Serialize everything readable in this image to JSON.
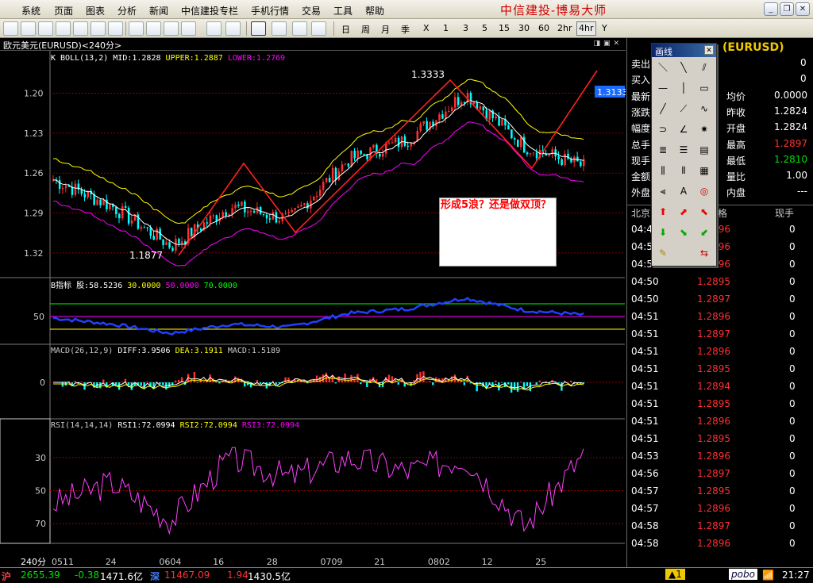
{
  "menu": {
    "items": [
      "系统",
      "页面",
      "图表",
      "分析",
      "新闻",
      "中信建投专栏",
      "手机行情",
      "交易",
      "工具",
      "帮助"
    ],
    "brand": "中信建投-博易大师"
  },
  "toolbar": {
    "periods": [
      "日",
      "周",
      "月",
      "季",
      "X",
      "1",
      "3",
      "5",
      "15",
      "30",
      "60",
      "2hr",
      "4hr",
      "Y"
    ],
    "selected_period": "4hr"
  },
  "chart": {
    "title": "欧元美元(EURUSD)<240分>",
    "period_label": "240分",
    "boll": {
      "label": "K BOLL(13,2)",
      "mid": "MID:1.2828",
      "upper": "UPPER:1.2887",
      "lower": "LOWER:1.2769"
    },
    "price_ticks": [
      "1.32",
      "1.29",
      "1.26",
      "1.23",
      "1.20"
    ],
    "high_label": "1.3333",
    "low_label": "1.1877",
    "current_price": "1.3133",
    "b_indicator": {
      "label": "B指标",
      "value": "股:58.5236",
      "l1": "30.0000",
      "l2": "50.0000",
      "l3": "70.0000",
      "tick": "50"
    },
    "macd": {
      "label": "MACD(26,12,9)",
      "diff": "DIFF:3.9506",
      "dea": "DEA:3.1911",
      "macd": "MACD:1.5189",
      "tick": "0"
    },
    "rsi": {
      "label": "RSI(14,14,14)",
      "rsi1": "RSI1:72.0994",
      "rsi2": "RSI2:72.0994",
      "rsi3": "RSI3:72.0994",
      "ticks": [
        "70",
        "50",
        "30"
      ]
    },
    "dates": [
      "0511",
      "24",
      "0604",
      "16",
      "28",
      "0709",
      "21",
      "0802",
      "12",
      "25"
    ],
    "annotation": "形成5浪？还是做双顶？"
  },
  "chart_data": [
    {
      "type": "line",
      "title": "K BOLL(13,2)",
      "note": "EURUSD 4-hour candles with Bollinger bands",
      "x": [
        "0511",
        "24",
        "0604",
        "16",
        "28",
        "0709",
        "21",
        "0802",
        "12",
        "25"
      ],
      "series": [
        {
          "name": "MID",
          "values": [
            1.255,
            1.235,
            1.205,
            1.235,
            1.225,
            1.27,
            1.285,
            1.32,
            1.28,
            1.265
          ]
        }
      ],
      "ylim": [
        1.185,
        1.34
      ],
      "yticks": [
        1.2,
        1.23,
        1.26,
        1.29,
        1.32
      ],
      "high": 1.3333,
      "low": 1.1877,
      "last": 1.3133,
      "bands": {
        "MID": 1.2828,
        "UPPER": 1.2887,
        "LOWER": 1.2769
      }
    },
    {
      "type": "line",
      "title": "B指标",
      "values": {
        "股": 58.5236
      },
      "levels": [
        30,
        50,
        70
      ]
    },
    {
      "type": "bar",
      "title": "MACD(26,12,9)",
      "values": {
        "DIFF": 3.9506,
        "DEA": 3.1911,
        "MACD": 1.5189
      }
    },
    {
      "type": "line",
      "title": "RSI(14,14,14)",
      "x": [
        "0511",
        "24",
        "0604",
        "16",
        "28",
        "0709",
        "21",
        "0802",
        "12",
        "25"
      ],
      "series": [
        {
          "name": "RSI1",
          "values": [
            42,
            55,
            32,
            70,
            58,
            70,
            62,
            70,
            28,
            72
          ]
        }
      ],
      "yticks": [
        30,
        50,
        70
      ]
    }
  ],
  "quote": {
    "symbol": "(EURUSD)",
    "rows": [
      {
        "label": "卖出",
        "value": "0"
      },
      {
        "label": "买入",
        "value": "0"
      },
      {
        "label": "最新",
        "k2": "均价",
        "v2": "0.0000"
      },
      {
        "label": "涨跌",
        "k2": "昨收",
        "v2": "1.2824"
      },
      {
        "label": "幅度",
        "k2": "开盘",
        "v2": "1.2824"
      },
      {
        "label": "总手",
        "k2": "最高",
        "v2": "1.2897"
      },
      {
        "label": "现手",
        "k2": "最低",
        "v2": "1.2810"
      },
      {
        "label": "金额",
        "k2": "量比",
        "v2": "1.00"
      },
      {
        "label": "外盘",
        "k2": "内盘",
        "v2": "---"
      }
    ],
    "tick_header": {
      "c1": "北京",
      "c2": "格",
      "c3": "现手"
    },
    "ticks": [
      {
        "t": "04:48",
        "p": "1.2896",
        "v": "0"
      },
      {
        "t": "04:50",
        "p": "1.2896",
        "v": "0"
      },
      {
        "t": "04:50",
        "p": "1.2896",
        "v": "0"
      },
      {
        "t": "04:50",
        "p": "1.2895",
        "v": "0"
      },
      {
        "t": "04:50",
        "p": "1.2897",
        "v": "0"
      },
      {
        "t": "04:51",
        "p": "1.2896",
        "v": "0"
      },
      {
        "t": "04:51",
        "p": "1.2897",
        "v": "0"
      },
      {
        "t": "04:51",
        "p": "1.2896",
        "v": "0"
      },
      {
        "t": "04:51",
        "p": "1.2895",
        "v": "0"
      },
      {
        "t": "04:51",
        "p": "1.2894",
        "v": "0"
      },
      {
        "t": "04:51",
        "p": "1.2895",
        "v": "0"
      },
      {
        "t": "04:51",
        "p": "1.2896",
        "v": "0"
      },
      {
        "t": "04:51",
        "p": "1.2895",
        "v": "0"
      },
      {
        "t": "04:53",
        "p": "1.2896",
        "v": "0"
      },
      {
        "t": "04:56",
        "p": "1.2897",
        "v": "0"
      },
      {
        "t": "04:57",
        "p": "1.2895",
        "v": "0"
      },
      {
        "t": "04:57",
        "p": "1.2896",
        "v": "0"
      },
      {
        "t": "04:58",
        "p": "1.2897",
        "v": "0"
      },
      {
        "t": "04:58",
        "p": "1.2896",
        "v": "0"
      }
    ]
  },
  "drawtools": {
    "title": "画线",
    "close": "✕"
  },
  "status": {
    "sh_label": "沪",
    "sh_idx": "2655.39",
    "sh_chg": "-0.38",
    "sh_amt": "1471.6亿",
    "sz_label": "深",
    "sz_idx": "11467.09",
    "sz_chg": "1.94",
    "sz_amt": "1430.5亿",
    "alert": "▲1",
    "brand": "pobo",
    "time": "21:27"
  },
  "colors": {
    "up": "#ff3030",
    "down": "#00ffff",
    "boll_upper": "#ffff00",
    "boll_lower": "#ff00ff",
    "gridline": "#8b0000",
    "accent": "#f0c800",
    "trend": "#ff2020"
  }
}
